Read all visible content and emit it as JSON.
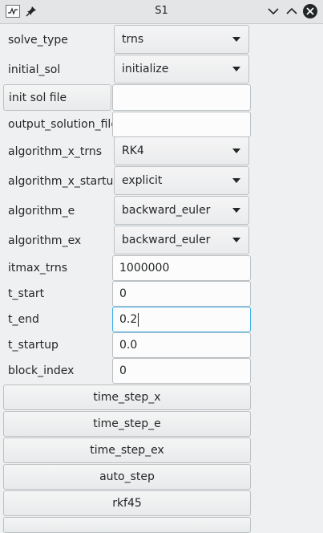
{
  "window": {
    "title": "S1"
  },
  "rows": {
    "solve_type": {
      "label": "solve_type",
      "value": "trns"
    },
    "initial_sol": {
      "label": "initial_sol",
      "value": "initialize"
    },
    "init_sol_file": {
      "button_label": "init sol file",
      "value": ""
    },
    "output_solution_file": {
      "label": "output_solution_file",
      "value": ""
    },
    "algorithm_x_trns": {
      "label": "algorithm_x_trns",
      "value": "RK4"
    },
    "algorithm_x_startup": {
      "label": "algorithm_x_startup",
      "value": "explicit"
    },
    "algorithm_e": {
      "label": "algorithm_e",
      "value": "backward_euler"
    },
    "algorithm_ex": {
      "label": "algorithm_ex",
      "value": "backward_euler"
    },
    "itmax_trns": {
      "label": "itmax_trns",
      "value": "1000000"
    },
    "t_start": {
      "label": "t_start",
      "value": "0"
    },
    "t_end": {
      "label": "t_end",
      "value": "0.2"
    },
    "t_startup": {
      "label": "t_startup",
      "value": "0.0"
    },
    "block_index": {
      "label": "block_index",
      "value": "0"
    }
  },
  "buttons": {
    "time_step_x": "time_step_x",
    "time_step_e": "time_step_e",
    "time_step_ex": "time_step_ex",
    "auto_step": "auto_step",
    "rkf45": "rkf45"
  },
  "icons": {
    "app": "waveform-icon",
    "pin": "pin-icon",
    "minimize": "chevron-down-icon",
    "maximize": "chevron-up-icon",
    "close": "close-icon"
  },
  "colors": {
    "focus_border": "#3daee9",
    "window_bg": "#eff0f1",
    "close_button": "#232627"
  }
}
